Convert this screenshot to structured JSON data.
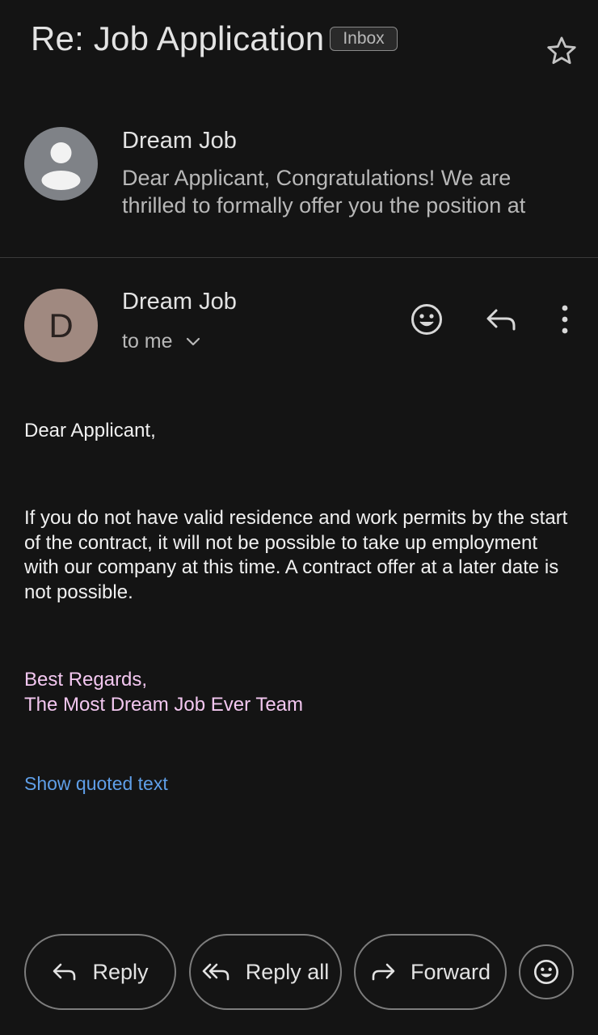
{
  "thread": {
    "subject": "Re: Job Application",
    "label_badge": "Inbox"
  },
  "collapsed_message": {
    "sender": "Dream Job",
    "snippet": "Dear Applicant, Congratulations! We are thrilled to formally offer you the position at"
  },
  "expanded_message": {
    "avatar_letter": "D",
    "sender": "Dream Job",
    "recipient": "to me",
    "body": {
      "greeting": "Dear Applicant,",
      "paragraph": "If you do not have valid residence and work permits by the start of the contract, it will not be possible to take up employment with our company at this time. A contract offer at a later date is not possible.",
      "signoff_line1": "Best Regards,",
      "signoff_line2": "The Most Dream Job Ever Team"
    },
    "show_quoted_text": "Show quoted text"
  },
  "actions": {
    "reply": "Reply",
    "reply_all": "Reply all",
    "forward": "Forward"
  },
  "icons": {
    "star": "star-outline-icon",
    "header_emoji": "emoji-reaction-icon",
    "header_reply": "reply-icon",
    "more": "more-vert-icon"
  },
  "colors": {
    "background": "#141414",
    "signature_text": "#f3c7f0",
    "link": "#5f9fe8",
    "avatar_generic": "#7f8287",
    "avatar_letter_bg": "#a08980"
  }
}
